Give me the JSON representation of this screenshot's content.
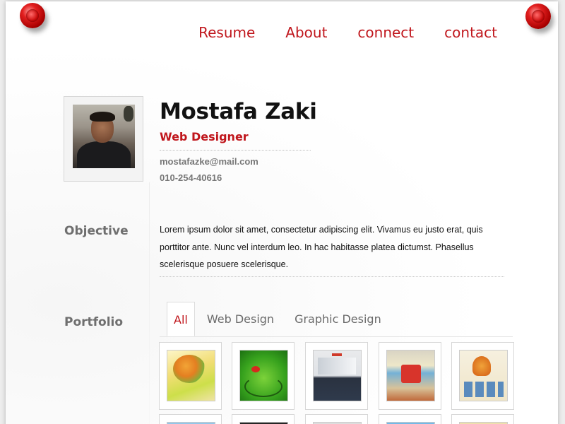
{
  "nav": {
    "items": [
      "Resume",
      "About",
      "connect",
      "contact"
    ]
  },
  "profile": {
    "name": "Mostafa Zaki",
    "title": "Web Designer",
    "email": "mostafazke@mail.com",
    "phone": "010-254-40616"
  },
  "sections": {
    "objective_label": "Objective",
    "objective_text": "Lorem ipsum dolor sit amet, consectetur adipiscing elit. Vivamus eu justo erat, quis porttitor ante. Nunc vel interdum leo. In hac habitasse platea dictumst. Phasellus scelerisque posuere scelerisque.",
    "portfolio_label": "Portfolio"
  },
  "portfolio": {
    "tabs": [
      "All",
      "Web Design",
      "Graphic Design"
    ],
    "active_tab": "All"
  },
  "colors": {
    "accent": "#c0161c",
    "label_gray": "#6f6f6f",
    "text_dark": "#111111"
  }
}
